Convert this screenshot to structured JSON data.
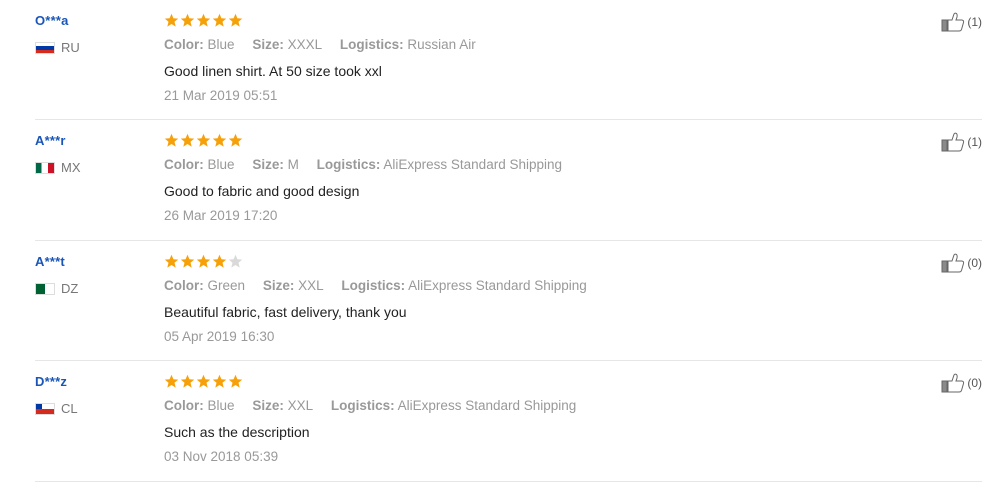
{
  "colors": {
    "username": "#1a56b8",
    "star_on": "#f7a10a",
    "star_off": "#d9d9d9",
    "muted": "#999999",
    "divider": "#e6e6e6"
  },
  "reviews": [
    {
      "user": "O***a",
      "country_code": "RU",
      "flag_icon": "flag-ru-icon",
      "rating": 5,
      "color_label": "Color:",
      "color_value": "Blue",
      "size_label": "Size:",
      "size_value": "XXXL",
      "logistics_label": "Logistics:",
      "logistics_value": "Russian Air",
      "comment": "Good linen shirt. At 50 size took xxl",
      "date": "21 Mar 2019 05:51",
      "helpful_count": "(1)"
    },
    {
      "user": "A***r",
      "country_code": "MX",
      "flag_icon": "flag-mx-icon",
      "rating": 5,
      "color_label": "Color:",
      "color_value": "Blue",
      "size_label": "Size:",
      "size_value": "M",
      "logistics_label": "Logistics:",
      "logistics_value": "AliExpress Standard Shipping",
      "comment": "Good to fabric and good design",
      "date": "26 Mar 2019 17:20",
      "helpful_count": "(1)"
    },
    {
      "user": "A***t",
      "country_code": "DZ",
      "flag_icon": "flag-dz-icon",
      "rating": 4,
      "color_label": "Color:",
      "color_value": "Green",
      "size_label": "Size:",
      "size_value": "XXL",
      "logistics_label": "Logistics:",
      "logistics_value": "AliExpress Standard Shipping",
      "comment": "Beautiful fabric, fast delivery, thank you",
      "date": "05 Apr 2019 16:30",
      "helpful_count": "(0)"
    },
    {
      "user": "D***z",
      "country_code": "CL",
      "flag_icon": "flag-cl-icon",
      "rating": 5,
      "color_label": "Color:",
      "color_value": "Blue",
      "size_label": "Size:",
      "size_value": "XXL",
      "logistics_label": "Logistics:",
      "logistics_value": "AliExpress Standard Shipping",
      "comment": "Such as the description",
      "date": "03 Nov 2018 05:39",
      "helpful_count": "(0)"
    }
  ]
}
